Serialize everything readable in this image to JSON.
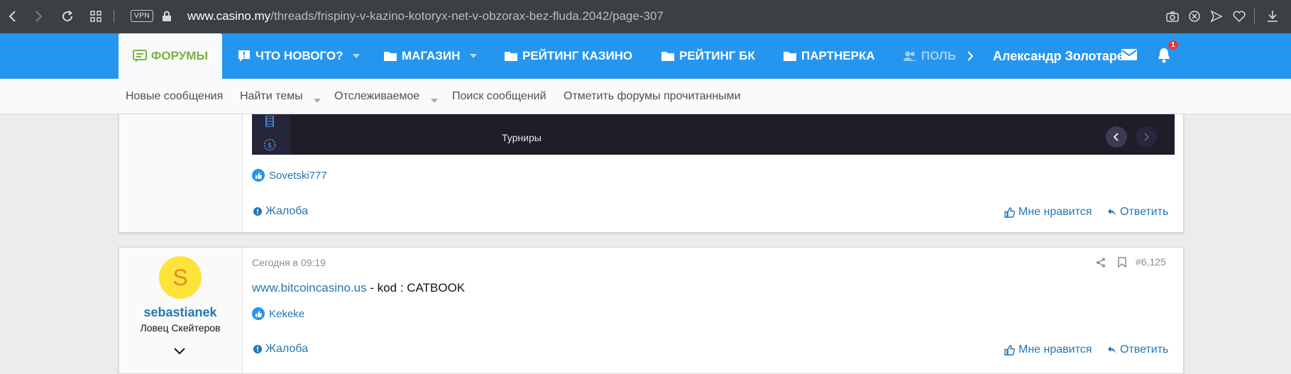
{
  "browser": {
    "vpn_label": "VPN",
    "url_host": "www.casino.my",
    "url_path": "/threads/frispiny-v-kazino-kotoryx-net-v-obzorax-bez-fluda.2042/page-307"
  },
  "nav": {
    "items": [
      {
        "label": "ФОРУМЫ",
        "icon": "forum-icon",
        "active": true
      },
      {
        "label": "ЧТО НОВОГО?",
        "icon": "comment-alert-icon"
      },
      {
        "label": "МАГАЗИН",
        "icon": "folder-icon"
      },
      {
        "label": "РЕЙТИНГ КАЗИНО",
        "icon": "folder-icon"
      },
      {
        "label": "РЕЙТИНГ БК",
        "icon": "folder-icon"
      },
      {
        "label": "ПАРТНЕРКА",
        "icon": "folder-icon"
      },
      {
        "label": "ПОЛЬ",
        "icon": "users-icon"
      }
    ],
    "user": "Александр Золотарев",
    "notification_count": "1",
    "colors": {
      "bar": "#2596f0",
      "active_text": "#7cb342"
    }
  },
  "subnav": {
    "items": [
      "Новые сообщения",
      "Найти темы",
      "Отслеживаемое",
      "Поиск сообщений",
      "Отметить форумы прочитанными"
    ]
  },
  "post1": {
    "embed_title": "Турниры",
    "reaction_user": "Sovetski777",
    "report_label": "Жалоба",
    "like_label": "Мне нравится",
    "reply_label": "Ответить"
  },
  "post2": {
    "avatar_letter": "S",
    "username": "sebastianek",
    "user_title": "Ловец Скейтеров",
    "date": "Сегодня в 09:19",
    "post_number": "#6,125",
    "body_link": "www.bitcoincasino.us",
    "body_text": " - kod : ",
    "body_code": "CATBOOK",
    "reaction_user": "Kekeke",
    "report_label": "Жалоба",
    "like_label": "Мне нравится",
    "reply_label": "Ответить"
  }
}
